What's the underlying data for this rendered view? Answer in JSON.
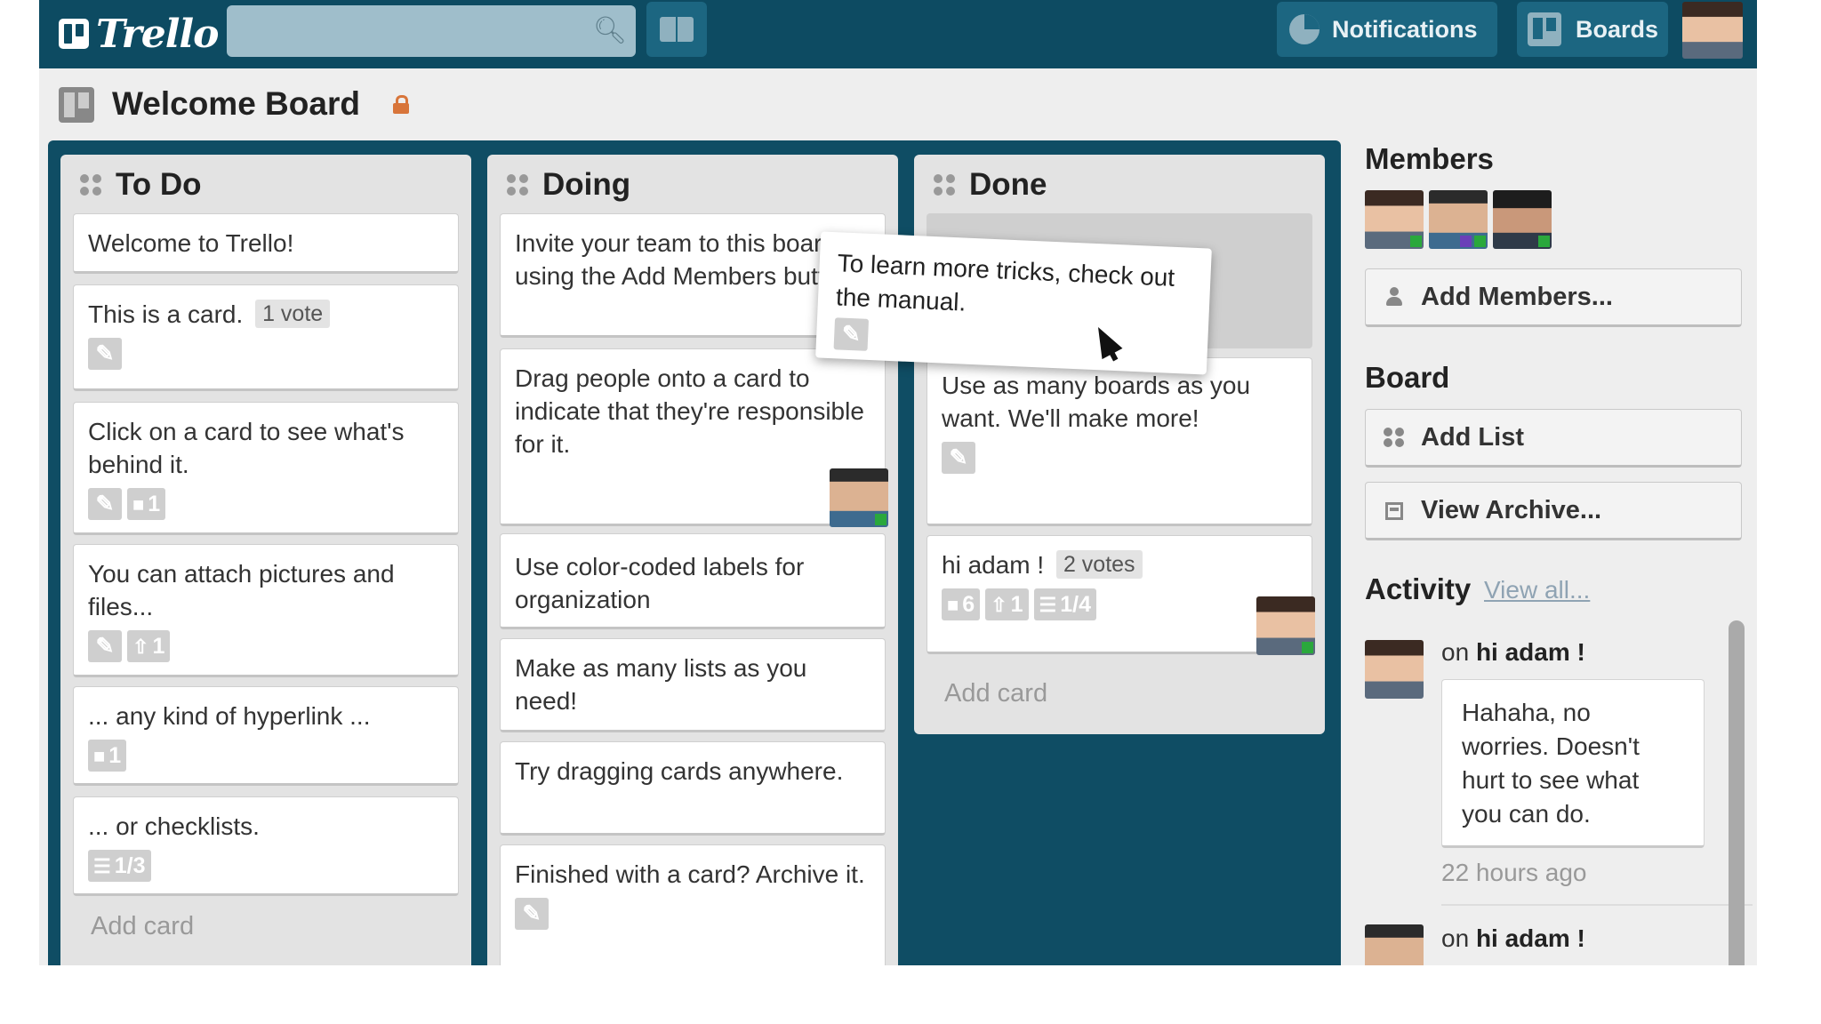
{
  "app": {
    "logo_text": "Trello",
    "notifications_label": "Notifications",
    "boards_label": "Boards"
  },
  "board": {
    "title": "Welcome Board"
  },
  "lists": [
    {
      "title": "To Do",
      "cards": [
        {
          "text": "Welcome to Trello!"
        },
        {
          "text": "This is a card.",
          "votes": "1 vote"
        },
        {
          "text": "Click on a card to see what's behind it.",
          "comments": "1"
        },
        {
          "text": "You can attach pictures and files...",
          "attachments": "1"
        },
        {
          "text": "... any kind of hyperlink ...",
          "comments": "1"
        },
        {
          "text": "... or checklists.",
          "checklist": "1/3"
        }
      ],
      "add_card": "Add card"
    },
    {
      "title": "Doing",
      "cards": [
        {
          "text": "Invite your team to this board using the Add Members button"
        },
        {
          "text": "Drag people onto a card to indicate that they're responsible for it."
        },
        {
          "text": "Use color-coded labels for organization"
        },
        {
          "text": "Make as many lists as you need!"
        },
        {
          "text": "Try dragging cards anywhere."
        },
        {
          "text": "Finished with a card? Archive it."
        }
      ]
    },
    {
      "title": "Done",
      "cards": [
        {
          "text": "Use as many boards as you want. We'll make more!"
        },
        {
          "text": "hi adam !",
          "votes": "2 votes",
          "comments": "6",
          "attachments": "1",
          "checklist": "1/4"
        }
      ],
      "add_card": "Add card"
    }
  ],
  "dragging_card": {
    "text": "To learn more tricks, check out the manual."
  },
  "sidebar": {
    "members_heading": "Members",
    "add_members": "Add Members...",
    "board_heading": "Board",
    "add_list": "Add List",
    "view_archive": "View Archive...",
    "activity_heading": "Activity",
    "view_all": "View all...",
    "activity": [
      {
        "prefix": "on",
        "target": "hi adam !",
        "comment": "Hahaha, no worries. Doesn't hurt to see what you can do.",
        "time": "22 hours ago"
      },
      {
        "prefix": "on",
        "target": "hi adam !"
      }
    ]
  },
  "colors": {
    "header": "#0d4b62",
    "board_bg": "#0f4d64",
    "label_green": "#34b249",
    "label_red": "#e02f2f"
  }
}
